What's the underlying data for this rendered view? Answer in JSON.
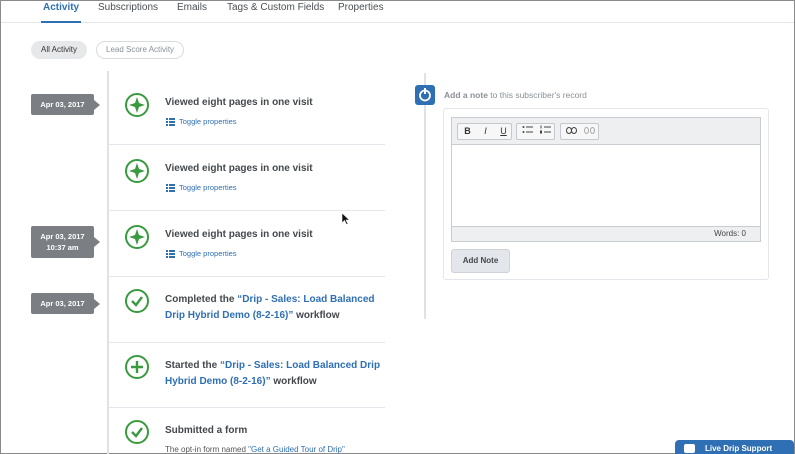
{
  "tabs": [
    {
      "label": "Activity",
      "active": true
    },
    {
      "label": "Subscriptions",
      "active": false
    },
    {
      "label": "Emails",
      "active": false
    },
    {
      "label": "Tags & Custom Fields",
      "active": false
    },
    {
      "label": "Properties",
      "active": false
    }
  ],
  "filters": {
    "all_activity": "All Activity",
    "lead_score_activity": "Lead Score Activity"
  },
  "dates": [
    {
      "date": "Apr 03, 2017",
      "time": ""
    },
    {
      "date": "Apr 03, 2017",
      "time": "10:37 am"
    },
    {
      "date": "Apr 03, 2017",
      "time": ""
    }
  ],
  "events": [
    {
      "title": "Viewed eight pages in one visit",
      "toggle": "Toggle properties",
      "icon": "compass-icon"
    },
    {
      "title": "Viewed eight pages in one visit",
      "toggle": "Toggle properties",
      "icon": "compass-icon"
    },
    {
      "title": "Viewed eight pages in one visit",
      "toggle": "Toggle properties",
      "icon": "compass-icon"
    },
    {
      "title_pre": "Completed the ",
      "title_link": "“Drip - Sales: Load Balanced Drip Hybrid Demo (8-2-16)”",
      "title_post": " workflow",
      "icon": "check-circle-icon"
    },
    {
      "title_pre": "Started the ",
      "title_link": "“Drip - Sales: Load Balanced Drip Hybrid Demo (8-2-16)”",
      "title_post": " workflow",
      "icon": "plus-circle-icon"
    },
    {
      "title": "Submitted a form",
      "desc_pre": "The opt-in form named ",
      "desc_link": "\"Get a Guided Tour of Drip\"",
      "icon": "check-circle-icon"
    }
  ],
  "note": {
    "heading_bold": "Add a note",
    "heading_rest": " to this subscriber's record",
    "toolbar": [
      "B",
      "I",
      "U"
    ],
    "words": "Words: 0",
    "button": "Add Note"
  },
  "live_support": "Live Drip Support",
  "colors": {
    "accent": "#2f6fb3",
    "success": "#3a9a3f",
    "date_tag": "#7b7f84"
  }
}
